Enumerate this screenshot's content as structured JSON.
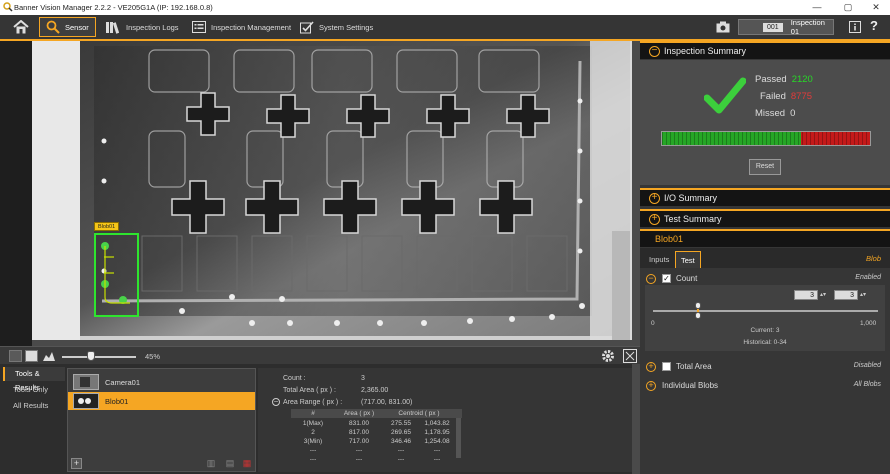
{
  "window": {
    "title": "Banner Vision Manager 2.2.2 - VE205G1A (IP: 192.168.0.8)",
    "min": "—",
    "max": "▢",
    "close": "✕"
  },
  "nav": {
    "tabs": [
      {
        "label": "Sensor",
        "icon": "search-sensor-icon",
        "active": true
      },
      {
        "label": "Inspection Logs",
        "icon": "books-icon"
      },
      {
        "label": "Inspection Management",
        "icon": "list-icon"
      },
      {
        "label": "System Settings",
        "icon": "settings-check-icon"
      }
    ],
    "inspection_number": "001",
    "inspection_name": "Inspection 01",
    "help": "?"
  },
  "image": {
    "roi_label": "Blob01"
  },
  "toolbar": {
    "zoom": "45%"
  },
  "tools_panel": {
    "side_tabs": [
      "Tools & Results",
      "Tools Only",
      "All Results"
    ],
    "tools": [
      {
        "name": "Camera01",
        "active": false
      },
      {
        "name": "Blob01",
        "active": true
      }
    ],
    "add": "+"
  },
  "results": {
    "count_label": "Count :",
    "count_value": "3",
    "total_area_label": "Total Area ( px ) :",
    "total_area_value": "2,365.00",
    "area_range_label": "Area Range ( px ) :",
    "area_range_value": "(717.00, 831.00)",
    "table": {
      "headers": [
        "#",
        "Area ( px )",
        "Centroid ( px )"
      ],
      "rows": [
        [
          "1(Max)",
          "831.00",
          "275.55",
          "1,043.82"
        ],
        [
          "2",
          "817.00",
          "269.65",
          "1,178.95"
        ],
        [
          "3(Min)",
          "717.00",
          "346.46",
          "1,254.08"
        ],
        [
          "---",
          "---",
          "---",
          "---"
        ],
        [
          "---",
          "---",
          "---",
          "---"
        ]
      ]
    }
  },
  "summary": {
    "title": "Inspection Summary",
    "passed_label": "Passed",
    "passed_value": "2120",
    "failed_label": "Failed",
    "failed_value": "8775",
    "missed_label": "Missed",
    "missed_value": "0",
    "pass_fraction": 0.67,
    "reset": "Reset",
    "pass_color": "#27d827",
    "fail_color": "#e23a3a"
  },
  "io_summary": "I/O Summary",
  "test_summary": "Test Summary",
  "blob": {
    "header": "Blob01",
    "tabs": [
      "Inputs",
      "Test"
    ],
    "tag": "Blob",
    "count": {
      "label": "Count",
      "status": "Enabled",
      "min": "3",
      "max": "3",
      "range_min": "0",
      "range_max": "1,000",
      "current": "Current: 3",
      "historical": "Historical: 0-34"
    },
    "total_area": {
      "label": "Total Area",
      "status": "Disabled"
    },
    "individual_blobs": {
      "label": "Individual Blobs",
      "status": "All Blobs"
    }
  }
}
